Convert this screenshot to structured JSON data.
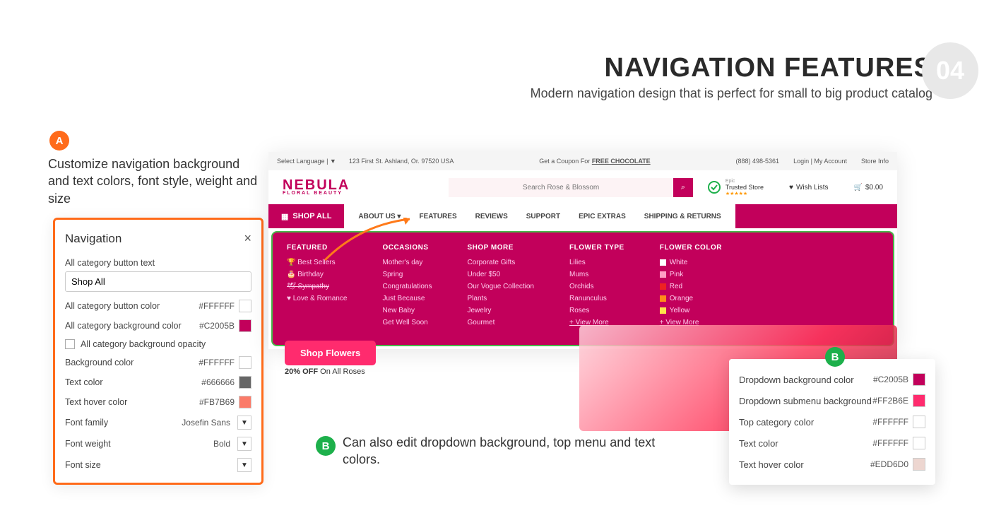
{
  "header": {
    "title": "NAVIGATION FEATURES",
    "subtitle": "Modern navigation design that is perfect for small to big product catalog",
    "num": "04"
  },
  "section_a": {
    "badge": "A",
    "text": "Customize navigation background and text colors, font style, weight and size"
  },
  "nav_panel": {
    "title": "Navigation",
    "all_cat_text_label": "All category button text",
    "all_cat_text_value": "Shop All",
    "btn_color_label": "All category button color",
    "btn_color_value": "#FFFFFF",
    "bg_color_label": "All category background color",
    "bg_color_value": "#C2005B",
    "opacity_label": "All category background opacity",
    "background_label": "Background color",
    "background_value": "#FFFFFF",
    "text_color_label": "Text color",
    "text_color_value": "#666666",
    "hover_label": "Text hover color",
    "hover_value": "#FB7B69",
    "font_family_label": "Font family",
    "font_family_value": "Josefin Sans",
    "font_weight_label": "Font weight",
    "font_weight_value": "Bold",
    "font_size_label": "Font size"
  },
  "preview": {
    "lang": "Select Language",
    "address": "123 First St. Ashland, Or. 97520 USA",
    "coupon_pre": "Get a Coupon For ",
    "coupon_link": "FREE CHOCOLATE",
    "phone": "(888) 498-5361",
    "login": "Login | My Account",
    "store_info": "Store Info",
    "logo": "NEBULA",
    "logo_sub": "FLORAL BEAUTY",
    "search_placeholder": "Search Rose & Blossom",
    "trusted": "Trusted Store",
    "wishlist": "Wish Lists",
    "cart": "$0.00",
    "shop_all": "SHOP ALL",
    "nav": [
      "ABOUT US",
      "FEATURES",
      "REVIEWS",
      "SUPPORT",
      "EPIC EXTRAS",
      "SHIPPING & RETURNS"
    ],
    "mega": {
      "featured": {
        "title": "FEATURED",
        "items": [
          "Best Sellers",
          "Birthday",
          "Sympathy",
          "Love & Romance"
        ]
      },
      "occasions": {
        "title": "OCCASIONS",
        "items": [
          "Mother's day",
          "Spring",
          "Congratulations",
          "Just Because",
          "New Baby",
          "Get Well Soon"
        ]
      },
      "shopmore": {
        "title": "SHOP MORE",
        "items": [
          "Corporate Gifts",
          "Under $50",
          "Our Vogue Collection",
          "Plants",
          "Jewelry",
          "Gourmet"
        ]
      },
      "flowertype": {
        "title": "FLOWER TYPE",
        "items": [
          "Lilies",
          "Mums",
          "Orchids",
          "Ranunculus",
          "Roses"
        ],
        "viewmore": "+ View More"
      },
      "flowercolor": {
        "title": "FLOWER COLOR",
        "items": [
          "White",
          "Pink",
          "Red",
          "Orange",
          "Yellow"
        ],
        "colors": [
          "#ffffff",
          "#ff9ec5",
          "#e22",
          "#ff8c1a",
          "#ffe24a"
        ],
        "viewmore": "+ View More"
      }
    },
    "shop_flowers": "Shop Flowers",
    "promo_pre": "20% OFF",
    "promo_post": " On All Roses"
  },
  "section_b": {
    "badge": "B",
    "text": "Can also edit dropdown background, top menu and text colors."
  },
  "panel_b": {
    "dd_bg_label": "Dropdown background color",
    "dd_bg_value": "#C2005B",
    "dd_sub_label": "Dropdown submenu background",
    "dd_sub_value": "#FF2B6E",
    "top_cat_label": "Top category color",
    "top_cat_value": "#FFFFFF",
    "text_label": "Text color",
    "text_value": "#FFFFFF",
    "hover_label": "Text hover color",
    "hover_value": "#EDD6D0"
  }
}
